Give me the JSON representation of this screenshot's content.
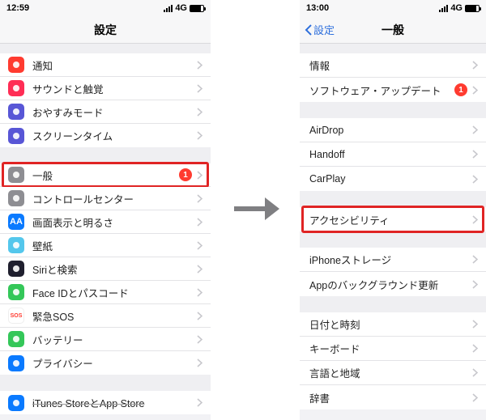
{
  "left": {
    "status": {
      "time": "12:59",
      "net": "4G"
    },
    "nav": {
      "title": "設定"
    },
    "groups": [
      [
        {
          "key": "notifications",
          "label": "通知",
          "icon": "#ff3b30",
          "iconName": "notifications-icon"
        },
        {
          "key": "sounds",
          "label": "サウンドと触覚",
          "icon": "#ff2d55",
          "iconName": "sounds-icon"
        },
        {
          "key": "dnd",
          "label": "おやすみモード",
          "icon": "#5856d6",
          "iconName": "moon-icon"
        },
        {
          "key": "screentime",
          "label": "スクリーンタイム",
          "icon": "#5856d6",
          "iconName": "hourglass-icon"
        }
      ],
      [
        {
          "key": "general",
          "label": "一般",
          "icon": "#8e8e93",
          "iconName": "gear-icon",
          "badge": "1",
          "highlight": true
        },
        {
          "key": "controlcenter",
          "label": "コントロールセンター",
          "icon": "#8e8e93",
          "iconName": "switches-icon"
        },
        {
          "key": "display",
          "label": "画面表示と明るさ",
          "icon": "#0a7aff",
          "glyph": "AA",
          "iconName": "display-icon"
        },
        {
          "key": "wallpaper",
          "label": "壁紙",
          "icon": "#54c7ec",
          "iconName": "wallpaper-icon"
        },
        {
          "key": "siri",
          "label": "Siriと検索",
          "icon": "#1f1f2e",
          "iconName": "siri-icon"
        },
        {
          "key": "faceid",
          "label": "Face IDとパスコード",
          "icon": "#34c759",
          "iconName": "faceid-icon"
        },
        {
          "key": "sos",
          "label": "緊急SOS",
          "icon": "#ffffff",
          "glyph": "SOS",
          "glyphColor": "#ff3b30",
          "iconName": "sos-icon"
        },
        {
          "key": "battery",
          "label": "バッテリー",
          "icon": "#34c759",
          "iconName": "battery-icon"
        },
        {
          "key": "privacy",
          "label": "プライバシー",
          "icon": "#0a7aff",
          "iconName": "hand-icon"
        }
      ],
      [
        {
          "key": "itunes",
          "label": "iTunes StoreとApp Store",
          "icon": "#0a7aff",
          "iconName": "appstore-icon",
          "strike": true
        }
      ]
    ]
  },
  "right": {
    "status": {
      "time": "13:00",
      "net": "4G"
    },
    "nav": {
      "back": "設定",
      "title": "一般"
    },
    "groups": [
      [
        {
          "key": "about",
          "label": "情報"
        },
        {
          "key": "swupdate",
          "label": "ソフトウェア・アップデート",
          "badge": "1"
        }
      ],
      [
        {
          "key": "airdrop",
          "label": "AirDrop"
        },
        {
          "key": "handoff",
          "label": "Handoff"
        },
        {
          "key": "carplay",
          "label": "CarPlay"
        }
      ],
      [
        {
          "key": "accessibility",
          "label": "アクセシビリティ",
          "highlight": true
        }
      ],
      [
        {
          "key": "iphonestorage",
          "label": "iPhoneストレージ"
        },
        {
          "key": "bgrefresh",
          "label": "Appのバックグラウンド更新"
        }
      ],
      [
        {
          "key": "datetime",
          "label": "日付と時刻"
        },
        {
          "key": "keyboard",
          "label": "キーボード"
        },
        {
          "key": "lang",
          "label": "言語と地域"
        },
        {
          "key": "dict",
          "label": "辞書"
        }
      ]
    ]
  }
}
